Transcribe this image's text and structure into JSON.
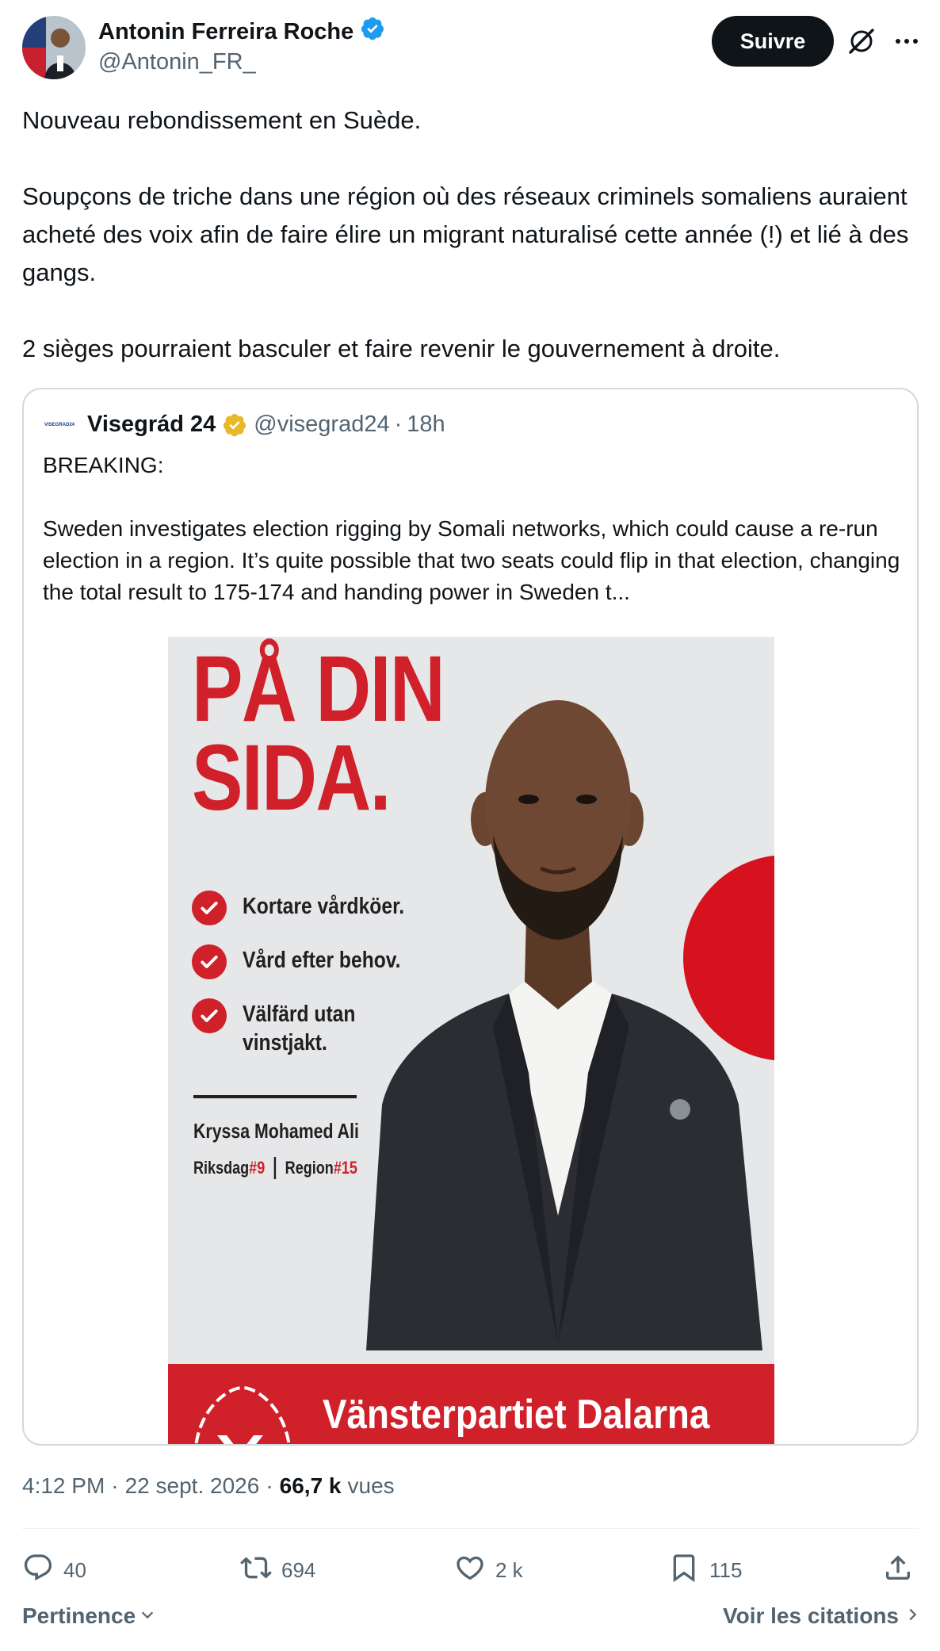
{
  "author": {
    "name": "Antonin Ferreira Roche",
    "handle": "@Antonin_FR_",
    "verified_color": "#1d9bf0"
  },
  "header": {
    "follow_label": "Suivre"
  },
  "tweet": {
    "lines": [
      "Nouveau rebondissement en Suède.",
      "Soupçons de triche dans une région où des réseaux criminels somaliens auraient acheté des voix afin de faire élire un migrant naturalisé cette année (!) et lié à des gangs.",
      "2 sièges pourraient basculer et faire revenir le gouvernement à droite."
    ]
  },
  "quote": {
    "logo_text": "VISEGRAD24",
    "name": "Visegrád 24",
    "handle": "@visegrad24",
    "time": "18h",
    "badge_color": "#e8b829",
    "text_lines": [
      "BREAKING:",
      "Sweden investigates election rigging by Somali networks, which could cause a re-run election in a region. It’s quite possible that two seats could flip in that election, changing the total result to 175-174 and handing power in Sweden t..."
    ],
    "poster": {
      "headline_1": "PÅ DIN",
      "headline_2": "SIDA.",
      "checks": [
        "Kortare vårdköer.",
        "Vård efter behov.",
        "Välfärd utan\nvinstjakt."
      ],
      "candidate": "Kryssa Mohamed Ali",
      "riksdag_label": "Riksdag",
      "riksdag_num": "#9",
      "region_label": "Region",
      "region_num": "#15",
      "band_text": "Vänsterpartiet Dalarna",
      "accent": "#d0202a"
    }
  },
  "meta": {
    "time": "4:12 PM",
    "date": "22 sept. 2026",
    "views_count": "66,7 k",
    "views_label": "vues"
  },
  "actions": {
    "replies": "40",
    "reposts": "694",
    "likes": "2 k",
    "bookmarks": "115"
  },
  "footer": {
    "sort_label": "Pertinence",
    "quotes_label": "Voir les citations"
  }
}
